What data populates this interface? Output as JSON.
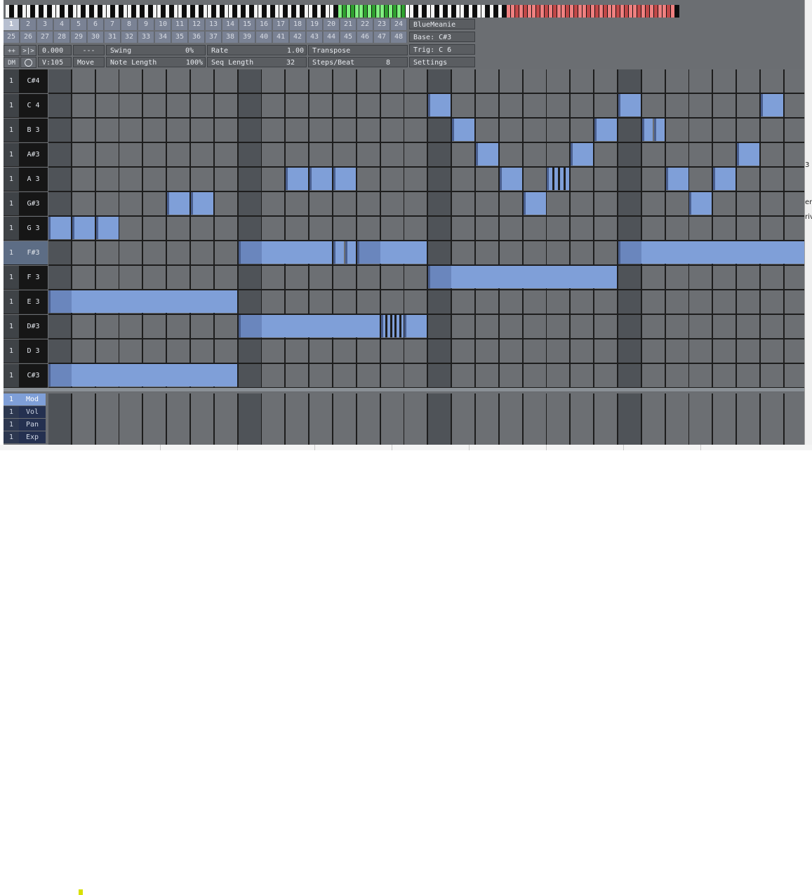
{
  "piano_strip": {
    "green_start": 79,
    "green_count": 16,
    "red_start": 119,
    "red_count": 40
  },
  "patterns": {
    "row1": [
      "1",
      "2",
      "3",
      "4",
      "5",
      "6",
      "7",
      "8",
      "9",
      "10",
      "11",
      "12",
      "13",
      "14",
      "15",
      "16",
      "17",
      "18",
      "19",
      "20",
      "21",
      "22",
      "23",
      "24"
    ],
    "row2": [
      "25",
      "26",
      "27",
      "28",
      "29",
      "30",
      "31",
      "32",
      "33",
      "34",
      "35",
      "36",
      "37",
      "38",
      "39",
      "40",
      "41",
      "42",
      "43",
      "44",
      "45",
      "46",
      "47",
      "48"
    ],
    "selected": "1"
  },
  "side_buttons": {
    "plusplus": "++",
    "skip": ">|>",
    "dm": "DM",
    "record_icon": "record-icon"
  },
  "header": {
    "time": "0.000",
    "dashes": "---",
    "swing_label": "Swing",
    "swing_value": "0%",
    "rate_label": "Rate",
    "rate_value": "1.00",
    "transpose": "Transpose",
    "velocity": "V:105",
    "move": "Move",
    "note_length_label": "Note Length",
    "note_length_value": "100%",
    "seq_length_label": "Seq Length",
    "seq_length_value": "32",
    "steps_beat_label": "Steps/Beat",
    "steps_beat_value": "8",
    "settings": "Settings",
    "name": "BlueMeanie",
    "base": "Base: C#3",
    "trig": "Trig: C 6"
  },
  "rows": [
    {
      "channel": "1",
      "note": "C#4"
    },
    {
      "channel": "1",
      "note": "C 4"
    },
    {
      "channel": "1",
      "note": "B 3"
    },
    {
      "channel": "1",
      "note": "A#3"
    },
    {
      "channel": "1",
      "note": "A 3"
    },
    {
      "channel": "1",
      "note": "G#3"
    },
    {
      "channel": "1",
      "note": "G 3"
    },
    {
      "channel": "1",
      "note": "F#3",
      "highlight": true
    },
    {
      "channel": "1",
      "note": "F 3"
    },
    {
      "channel": "1",
      "note": "E 3"
    },
    {
      "channel": "1",
      "note": "D#3"
    },
    {
      "channel": "1",
      "note": "D 3"
    },
    {
      "channel": "1",
      "note": "C#3"
    }
  ],
  "notes": [
    {
      "row": 1,
      "start": 16,
      "len": 1
    },
    {
      "row": 1,
      "start": 24,
      "len": 1
    },
    {
      "row": 1,
      "start": 30,
      "len": 1
    },
    {
      "row": 2,
      "start": 17,
      "len": 1
    },
    {
      "row": 2,
      "start": 23,
      "len": 1
    },
    {
      "row": 2,
      "start": 25,
      "len": 0.5
    },
    {
      "row": 2,
      "start": 25.5,
      "len": 0.5
    },
    {
      "row": 3,
      "start": 18,
      "len": 1
    },
    {
      "row": 3,
      "start": 22,
      "len": 1
    },
    {
      "row": 3,
      "start": 29,
      "len": 1
    },
    {
      "row": 4,
      "start": 10,
      "len": 1
    },
    {
      "row": 4,
      "start": 11,
      "len": 1
    },
    {
      "row": 4,
      "start": 12,
      "len": 1
    },
    {
      "row": 4,
      "start": 19,
      "len": 1
    },
    {
      "row": 4,
      "start": 21,
      "len": 1,
      "ratchet": 4
    },
    {
      "row": 4,
      "start": 26,
      "len": 1
    },
    {
      "row": 4,
      "start": 28,
      "len": 1
    },
    {
      "row": 5,
      "start": 5,
      "len": 1
    },
    {
      "row": 5,
      "start": 6,
      "len": 1
    },
    {
      "row": 5,
      "start": 20,
      "len": 1
    },
    {
      "row": 5,
      "start": 27,
      "len": 1
    },
    {
      "row": 6,
      "start": 0,
      "len": 1
    },
    {
      "row": 6,
      "start": 1,
      "len": 1
    },
    {
      "row": 6,
      "start": 2,
      "len": 1
    },
    {
      "row": 7,
      "start": 8,
      "len": 4
    },
    {
      "row": 7,
      "start": 12,
      "len": 0.5
    },
    {
      "row": 7,
      "start": 12.5,
      "len": 0.5
    },
    {
      "row": 7,
      "start": 13,
      "len": 3
    },
    {
      "row": 7,
      "start": 24,
      "len": 8
    },
    {
      "row": 8,
      "start": 16,
      "len": 8
    },
    {
      "row": 9,
      "start": 0,
      "len": 8
    },
    {
      "row": 10,
      "start": 8,
      "len": 6
    },
    {
      "row": 10,
      "start": 14,
      "len": 1,
      "ratchet": 5
    },
    {
      "row": 10,
      "start": 15,
      "len": 1
    },
    {
      "row": 12,
      "start": 0,
      "len": 8
    }
  ],
  "cc_lanes": [
    {
      "channel": "1",
      "name": "Mod",
      "selected": true
    },
    {
      "channel": "1",
      "name": "Vol"
    },
    {
      "channel": "1",
      "name": "Pan"
    },
    {
      "channel": "1",
      "name": "Exp"
    }
  ],
  "right_panel_fragments": [
    "3",
    "er",
    "riv"
  ],
  "colors": {
    "note": "#7f9fd8",
    "note_head": "#6a86bd",
    "beat_column": "#4f5358",
    "cell": "#6c6f73",
    "piano_green": "#7ff07f",
    "piano_red": "#f08080"
  }
}
